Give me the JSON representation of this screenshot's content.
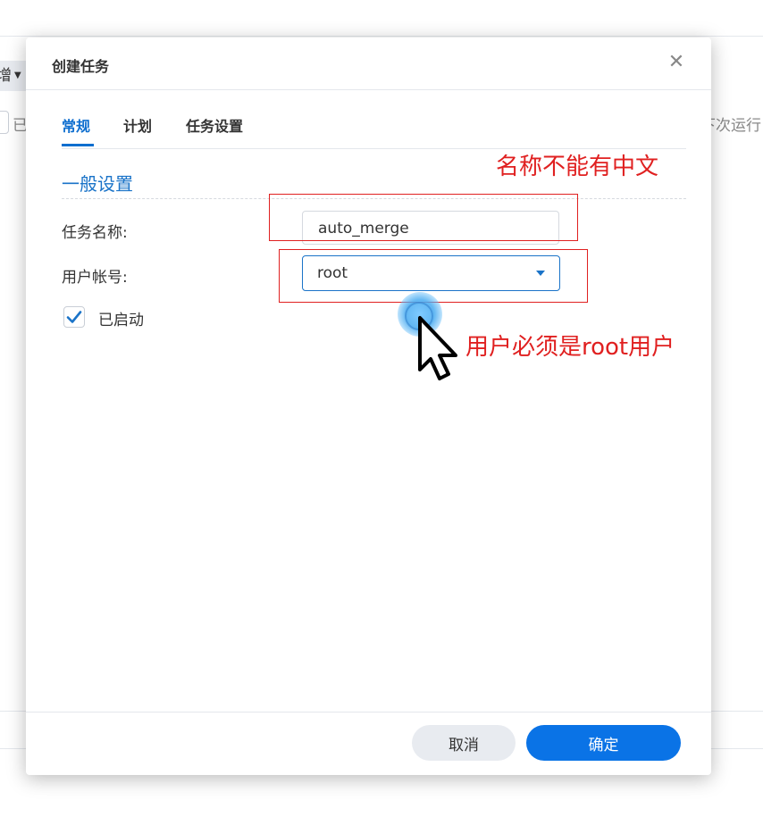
{
  "background": {
    "left_toolbar_text": "增",
    "left_row_text": "已",
    "right_row_text": "下次运行"
  },
  "dialog": {
    "title": "创建任务",
    "close_label": "✕",
    "tabs": [
      {
        "label": "常规",
        "active": true
      },
      {
        "label": "计划",
        "active": false
      },
      {
        "label": "任务设置",
        "active": false
      }
    ],
    "section_title": "一般设置",
    "task_name": {
      "label": "任务名称:",
      "value": "auto_merge"
    },
    "user_account": {
      "label": "用户帐号:",
      "value": "root"
    },
    "enabled": {
      "label": "已启动",
      "checked": true
    },
    "buttons": {
      "cancel": "取消",
      "ok": "确定"
    }
  },
  "annotations": {
    "name_note": "名称不能有中文",
    "user_note": "用户必须是root用户"
  },
  "colors": {
    "accent": "#0e6ecf",
    "primary_button": "#0a73e6",
    "annotation": "#e02020"
  }
}
